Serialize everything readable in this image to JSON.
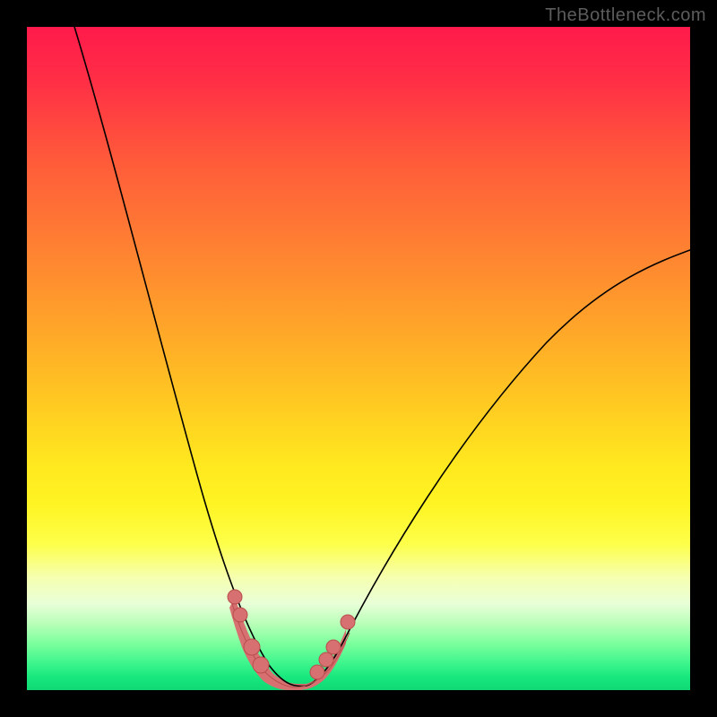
{
  "watermark": "TheBottleneck.com",
  "colors": {
    "dot_fill": "#d77070",
    "dot_stroke": "#b94e4e",
    "curve_stroke": "#000000"
  },
  "chart_data": {
    "type": "line",
    "title": "",
    "xlabel": "",
    "ylabel": "",
    "xlim": [
      0,
      100
    ],
    "ylim": [
      0,
      100
    ],
    "note": "No axes or tick labels are rendered; values below are normalized 0–100 estimates read from pixel positions (0 = left/bottom, 100 = right/top).",
    "series": [
      {
        "name": "left-branch",
        "x": [
          7,
          10,
          14,
          18,
          22,
          25,
          28,
          31,
          33,
          35,
          36.5,
          38
        ],
        "y": [
          100,
          88,
          73,
          58,
          44,
          33,
          23,
          15,
          9,
          5,
          2.5,
          1
        ]
      },
      {
        "name": "right-branch",
        "x": [
          42,
          44,
          47,
          51,
          56,
          62,
          69,
          77,
          86,
          95,
          100
        ],
        "y": [
          1,
          2.5,
          6,
          12,
          20,
          29,
          38,
          47,
          55,
          63,
          67
        ]
      },
      {
        "name": "flat-bottom",
        "x": [
          38,
          40,
          42
        ],
        "y": [
          1,
          0.5,
          1
        ]
      }
    ],
    "annotations": {
      "bottom_band": {
        "description": "Thick salmon band along the valley bottom visible roughly between y=0 and y=14 on both sides of the minimum",
        "x_range": [
          31,
          48
        ],
        "y_max": 14
      },
      "dots": [
        {
          "side": "left",
          "x": 31.5,
          "y": 14
        },
        {
          "side": "left",
          "x": 32.3,
          "y": 11
        },
        {
          "side": "left",
          "x": 34.0,
          "y": 6
        },
        {
          "side": "left",
          "x": 35.3,
          "y": 3.5
        },
        {
          "side": "right",
          "x": 43.8,
          "y": 2.5
        },
        {
          "side": "right",
          "x": 45.2,
          "y": 4.5
        },
        {
          "side": "right",
          "x": 46.3,
          "y": 6.5
        },
        {
          "side": "right",
          "x": 48.5,
          "y": 10
        }
      ]
    }
  }
}
